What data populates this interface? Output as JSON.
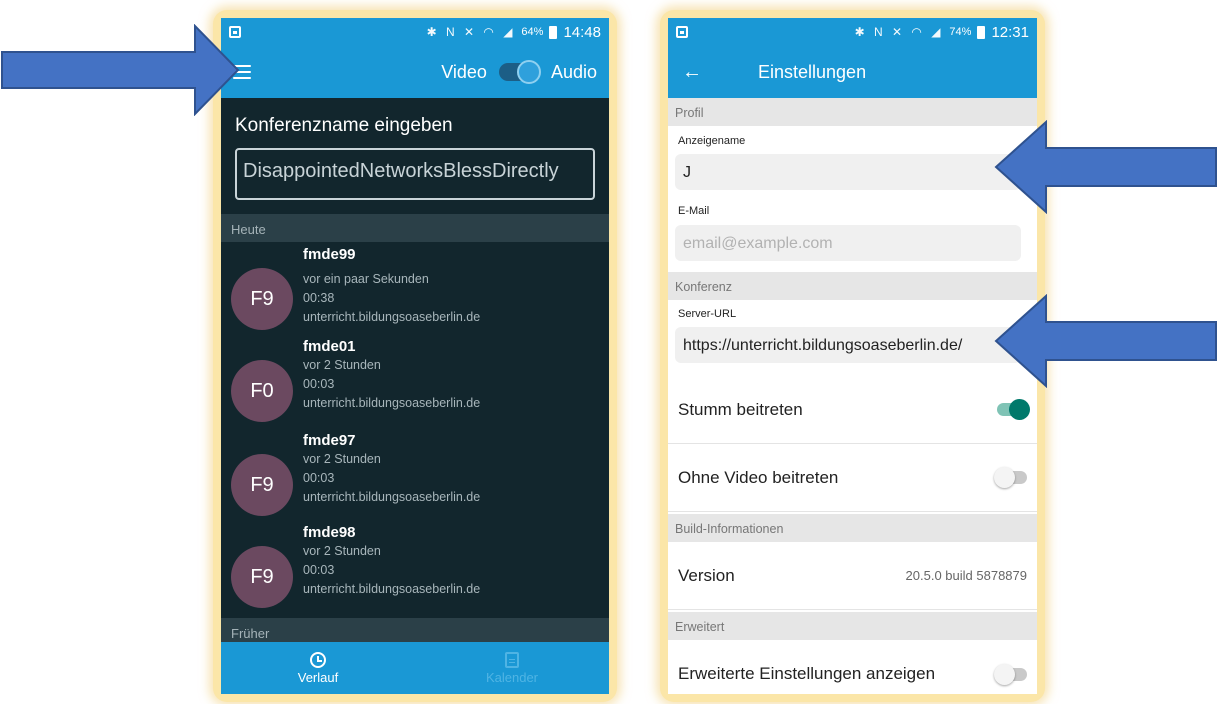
{
  "left_phone": {
    "status_bar": {
      "battery": "64%",
      "time": "14:48"
    },
    "app_bar": {
      "video_label": "Video",
      "audio_label": "Audio"
    },
    "conference_label": "Konferenzname eingeben",
    "conference_input": "DisappointedNetworksBlessDirectly",
    "section_today": "Heute",
    "section_earlier": "Früher",
    "history": [
      {
        "initials": "F9",
        "name": "fmde99",
        "time_ago": "vor ein paar Sekunden",
        "duration": "00:38",
        "server": "unterricht.bildungsoaseberlin.de"
      },
      {
        "initials": "F0",
        "name": "fmde01",
        "time_ago": "vor 2 Stunden",
        "duration": "00:03",
        "server": "unterricht.bildungsoaseberlin.de"
      },
      {
        "initials": "F9",
        "name": "fmde97",
        "time_ago": "vor 2 Stunden",
        "duration": "00:03",
        "server": "unterricht.bildungsoaseberlin.de"
      },
      {
        "initials": "F9",
        "name": "fmde98",
        "time_ago": "vor 2 Stunden",
        "duration": "00:03",
        "server": "unterricht.bildungsoaseberlin.de"
      }
    ],
    "bottom_nav": {
      "history_label": "Verlauf",
      "calendar_label": "Kalender"
    },
    "avatar_color": "#6b4960"
  },
  "right_phone": {
    "status_bar": {
      "battery": "74%",
      "time": "12:31"
    },
    "app_bar": {
      "title": "Einstellungen"
    },
    "section_profile": "Profil",
    "display_name_label": "Anzeigename",
    "display_name_value": "J",
    "email_label": "E-Mail",
    "email_placeholder": "email@example.com",
    "section_conference": "Konferenz",
    "server_url_label": "Server-URL",
    "server_url_value": "https://unterricht.bildungsoaseberlin.de/",
    "mute_join_label": "Stumm beitreten",
    "mute_join_on": true,
    "no_video_label": "Ohne Video beitreten",
    "no_video_on": false,
    "section_build": "Build-Informationen",
    "version_label": "Version",
    "version_value": "20.5.0 build 5878879",
    "section_advanced": "Erweitert",
    "advanced_label": "Erweiterte Einstellungen anzeigen",
    "advanced_on": false
  },
  "colors": {
    "accent_blue": "#1a98d5",
    "dark_background": "#12262d",
    "toggle_on": "#00796b",
    "arrow_fill": "#4472c4",
    "frame_highlight": "#fbe6a8"
  }
}
